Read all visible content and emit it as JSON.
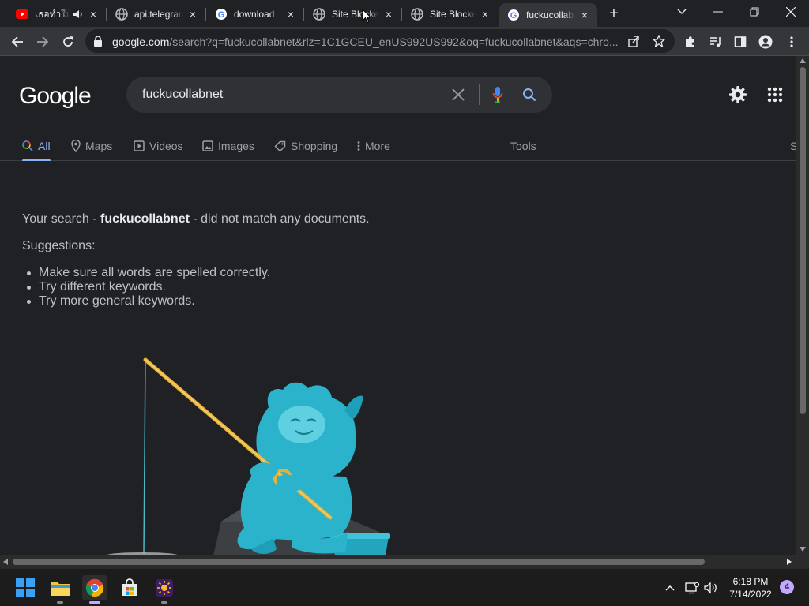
{
  "browser": {
    "tabs": [
      {
        "title": "เธอทำให้",
        "favicon": "youtube-icon",
        "audio": true
      },
      {
        "title": "api.telegram",
        "favicon": "globe-icon"
      },
      {
        "title": "download",
        "favicon": "google-icon"
      },
      {
        "title": "Site Blocker",
        "favicon": "globe-icon"
      },
      {
        "title": "Site Blocker",
        "favicon": "globe-icon"
      },
      {
        "title": "fuckucollab",
        "favicon": "google-icon",
        "active": true
      }
    ],
    "tab_close": "×",
    "new_tab": "+",
    "url_host": "google.com",
    "url_path": "/search?q=fuckucollabnet&rlz=1C1GCEU_enUS992US992&oq=fuckucollabnet&aqs=chro..."
  },
  "google": {
    "logo": "Google",
    "query": "fuckucollabnet",
    "tabs": [
      {
        "label": "All",
        "icon": "search-icon",
        "active": true
      },
      {
        "label": "Maps",
        "icon": "map-pin-icon"
      },
      {
        "label": "Videos",
        "icon": "video-icon"
      },
      {
        "label": "Images",
        "icon": "image-icon"
      },
      {
        "label": "Shopping",
        "icon": "tag-icon"
      },
      {
        "label": "More",
        "icon": "more-vertical-icon"
      }
    ],
    "tools": "Tools",
    "clipped_tab": "S",
    "message_prefix": "Your search - ",
    "message_query": "fuckucollabnet",
    "message_suffix": " - did not match any documents.",
    "suggestions_title": "Suggestions:",
    "suggestions": [
      "Make sure all words are spelled correctly.",
      "Try different keywords.",
      "Try more general keywords."
    ]
  },
  "taskbar": {
    "time": "6:18 PM",
    "date": "7/14/2022",
    "notification_count": "4"
  },
  "colors": {
    "accent": "#8ab4f8",
    "page_bg": "#202124",
    "chrome_bg": "#35363a"
  }
}
